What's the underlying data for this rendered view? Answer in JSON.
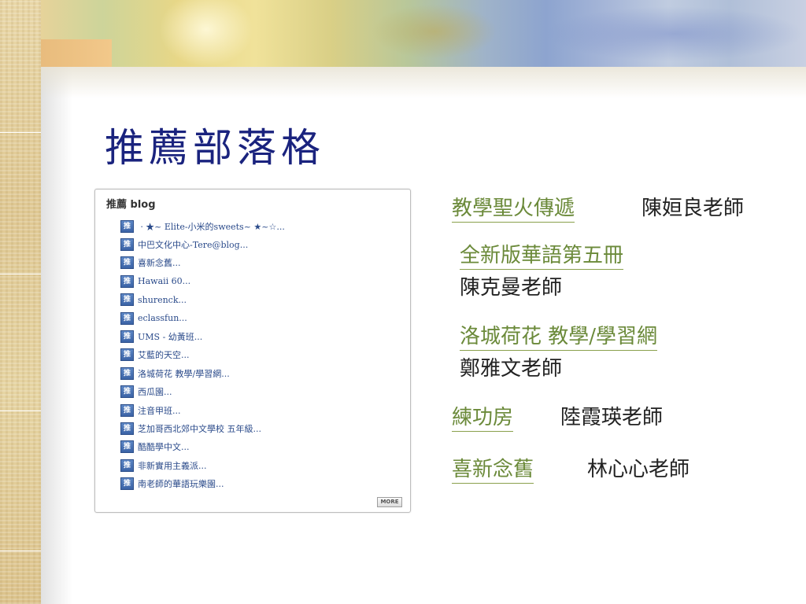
{
  "slide": {
    "title": "推薦部落格"
  },
  "widget": {
    "title": "推薦 blog",
    "icon_text": "推",
    "more_label": "MORE",
    "items": [
      "ㆍ★~ Elite-小米的sweets~ ★~☆...",
      "中巴文化中心-Tere@blog...",
      "喜新念舊...",
      "Hawaii 60...",
      "shurenck...",
      "eclassfun...",
      "UMS - 幼黃班...",
      "艾藍的天空...",
      "洛城荷花 教學/學習網...",
      "西瓜園...",
      "注音甲班...",
      "芝加哥西北郊中文學校 五年級...",
      "酷酷學中文...",
      "非新實用主義派...",
      "南老師的華語玩樂園..."
    ]
  },
  "links": [
    {
      "label": "教學聖火傳遞",
      "teacher": "陳姮良老師"
    },
    {
      "label": "全新版華語第五冊",
      "teacher": "陳克曼老師"
    },
    {
      "label": "洛城荷花 教學/學習網",
      "teacher": "鄭雅文老師"
    },
    {
      "label": "練功房",
      "teacher": "陸霞瑛老師"
    },
    {
      "label": "喜新念舊",
      "teacher": "林心心老師"
    }
  ],
  "colors": {
    "title": "#1a237e",
    "link": "#6b8a3a",
    "teacher": "#222222"
  }
}
